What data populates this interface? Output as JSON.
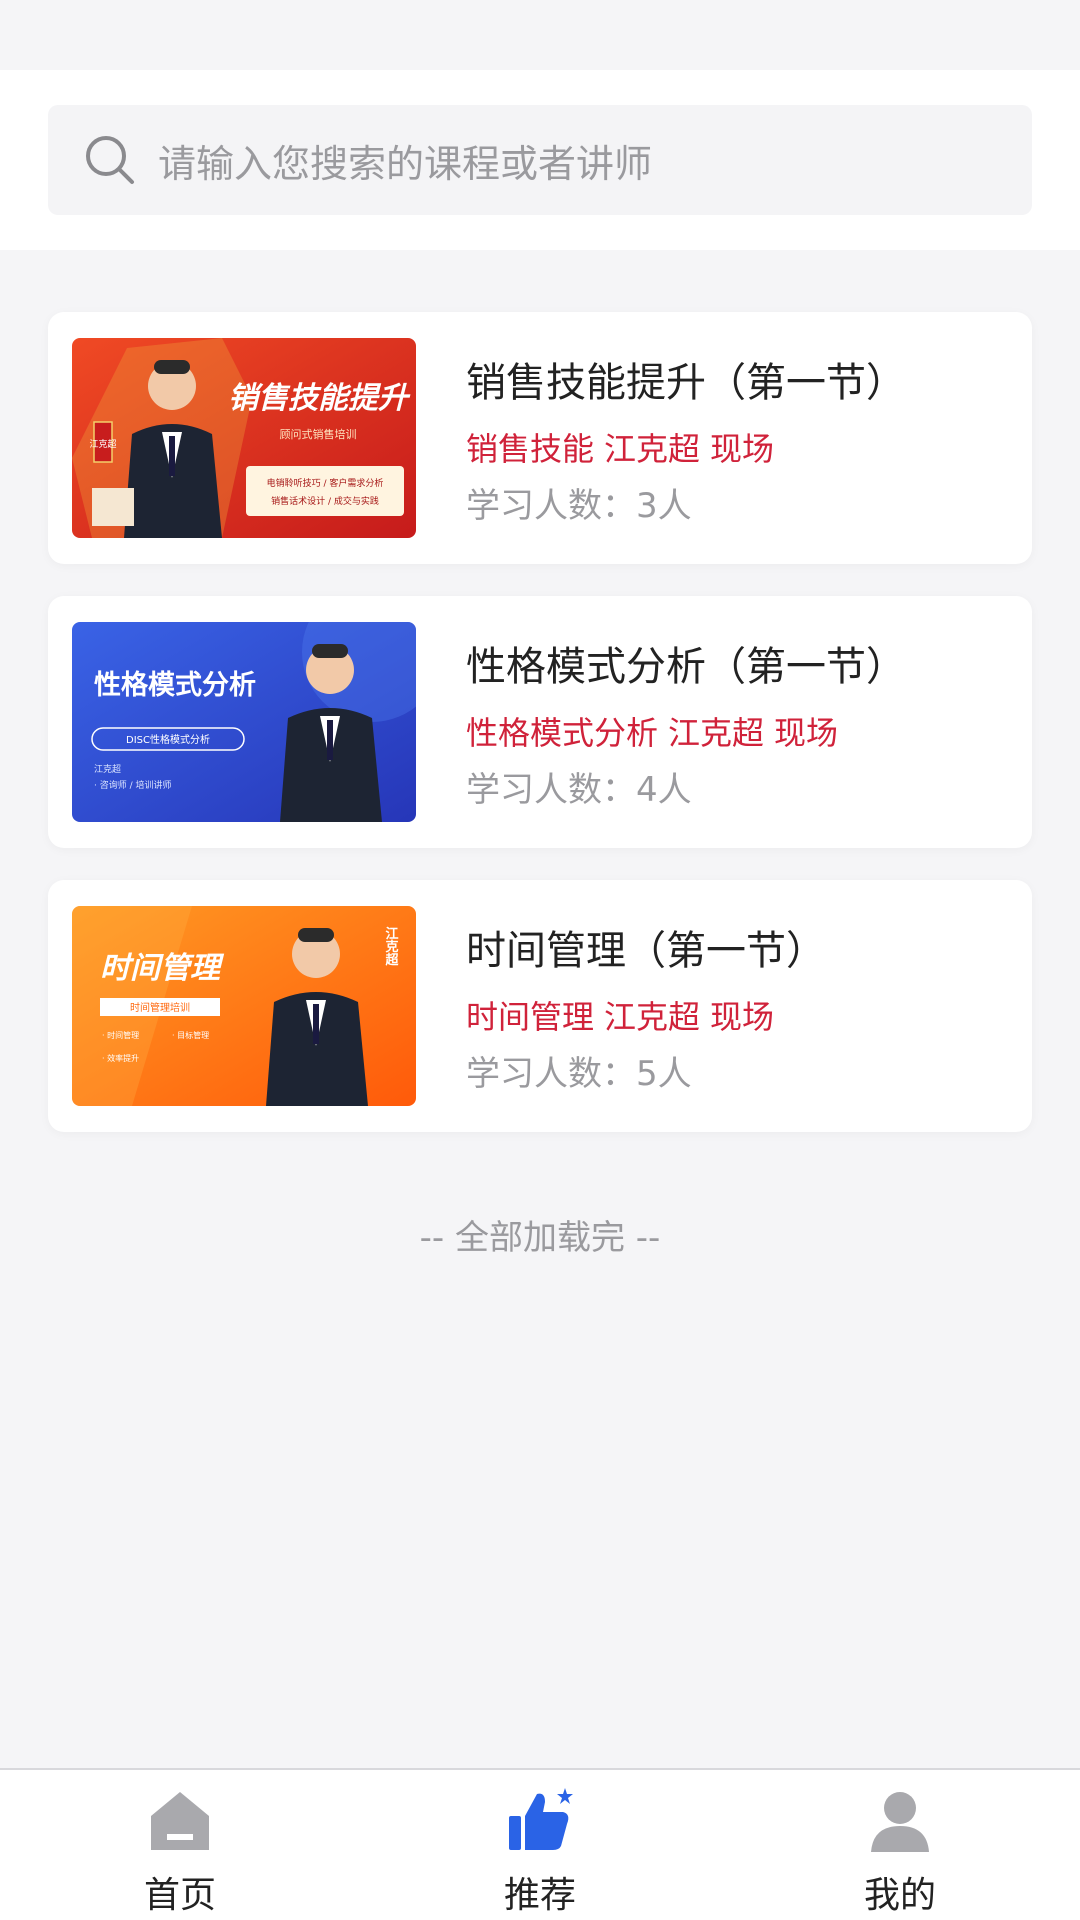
{
  "search": {
    "placeholder": "请输入您搜索的课程或者讲师"
  },
  "courses": [
    {
      "title": "销售技能提升（第一节）",
      "tags": [
        "销售技能",
        "江克超",
        "现场"
      ],
      "learners": "学习人数：3人",
      "thumb": {
        "headline": "销售技能提升",
        "subline": "顾问式销售培训",
        "lines": [
          "电销聆听技巧 / 客户需求分析",
          "销售话术设计 / 成交与实践"
        ],
        "name_tag": "江克超",
        "colors": [
          "#e8391f",
          "#c81d1d"
        ]
      }
    },
    {
      "title": "性格模式分析（第一节）",
      "tags": [
        "性格模式分析",
        "江克超",
        "现场"
      ],
      "learners": "学习人数：4人",
      "thumb": {
        "headline": "性格模式分析",
        "subline": "DISC性格模式分析",
        "lines": [
          "江克超",
          "· 咨询师 / 培训讲师"
        ],
        "colors": [
          "#2f55d8",
          "#2a3fc4"
        ]
      }
    },
    {
      "title": "时间管理（第一节）",
      "tags": [
        "时间管理",
        "江克超",
        "现场"
      ],
      "learners": "学习人数：5人",
      "thumb": {
        "headline": "时间管理",
        "subline": "时间管理培训",
        "lines": [
          "· 时间管理",
          "· 目标管理",
          "· 效率提升"
        ],
        "name_tag": "江克超",
        "colors": [
          "#ff8a1a",
          "#ff5c0a"
        ]
      }
    }
  ],
  "list_footer": "-- 全部加载完 --",
  "nav": {
    "items": [
      {
        "label": "首页",
        "icon": "home-icon",
        "active": false
      },
      {
        "label": "推荐",
        "icon": "thumbs-up-icon",
        "active": true
      },
      {
        "label": "我的",
        "icon": "user-icon",
        "active": false
      }
    ],
    "colors": {
      "active": "#2a63e6",
      "inactive": "#a9a9ad"
    }
  },
  "colors": {
    "tag": "#d0223a",
    "muted": "#9a9a9e",
    "title": "#222222",
    "background": "#f5f5f7"
  }
}
